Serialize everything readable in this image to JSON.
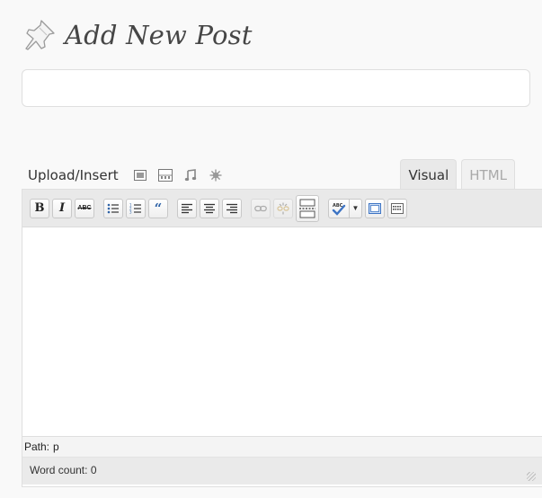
{
  "header": {
    "title": "Add New Post",
    "icon": "pushpin-icon"
  },
  "title_input": {
    "value": "",
    "placeholder": ""
  },
  "media": {
    "label": "Upload/Insert",
    "buttons": [
      "add-image-icon",
      "add-video-icon",
      "add-audio-icon",
      "add-media-icon"
    ]
  },
  "tabs": {
    "visual": "Visual",
    "html": "HTML",
    "active": "visual"
  },
  "toolbar": {
    "bold": "B",
    "italic": "I",
    "strikethrough": "ABC",
    "blockquote": "“",
    "buttons": [
      "bold",
      "italic",
      "strikethrough",
      "unordered-list",
      "ordered-list",
      "blockquote",
      "align-left",
      "align-center",
      "align-right",
      "insert-link",
      "unlink",
      "insert-more-tag",
      "spellcheck",
      "fullscreen",
      "kitchen-sink"
    ]
  },
  "editor": {
    "content": ""
  },
  "path_bar": {
    "label": "Path:",
    "value": "p"
  },
  "status": {
    "word_count_label": "Word count:",
    "word_count": "0"
  },
  "colors": {
    "background": "#f9f9f9",
    "toolbar": "#e9e9e9",
    "border": "#dfdfdf",
    "quote_blue": "#2f63a7",
    "spell_blue": "#3d74c4"
  }
}
